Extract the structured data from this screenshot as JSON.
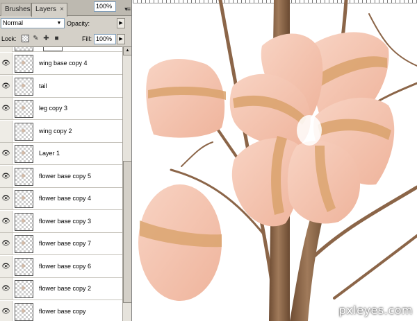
{
  "panel": {
    "tabs": [
      {
        "label": "Brushes",
        "active": false
      },
      {
        "label": "Layers",
        "active": true
      }
    ],
    "close_glyph": "×",
    "menu_glyph": "▾≡",
    "blend_mode": "Normal",
    "opacity_label": "Opacity:",
    "opacity_value": "100%",
    "lock_label": "Lock:",
    "fill_label": "Fill:",
    "fill_value": "100%",
    "layers": [
      {
        "name": "wing base copy 4",
        "visible": true
      },
      {
        "name": "tail",
        "visible": true
      },
      {
        "name": "leg copy 3",
        "visible": true
      },
      {
        "name": "wing copy 2",
        "visible": false
      },
      {
        "name": "Layer 1",
        "visible": true
      },
      {
        "name": "flower base copy 5",
        "visible": true
      },
      {
        "name": "flower base copy 4",
        "visible": true
      },
      {
        "name": "flower base copy 3",
        "visible": true
      },
      {
        "name": "flower base copy 7",
        "visible": true
      },
      {
        "name": "flower base copy 6",
        "visible": true
      },
      {
        "name": "flower base copy 2",
        "visible": true
      },
      {
        "name": "flower base copy",
        "visible": true
      }
    ]
  },
  "icons": {
    "eye": "eye-icon",
    "lock_transparent": "checkerboard-lock-icon",
    "lock_paint": "brush-lock-icon",
    "lock_move": "move-lock-icon",
    "lock_all": "padlock-icon"
  },
  "canvas": {
    "watermark": "pxleyes.com"
  },
  "colors": {
    "panel_bg": "#d4d0c8",
    "petal": "#f4c2ad",
    "petal_stripe": "#d9a26c",
    "stem": "#8b6548"
  }
}
